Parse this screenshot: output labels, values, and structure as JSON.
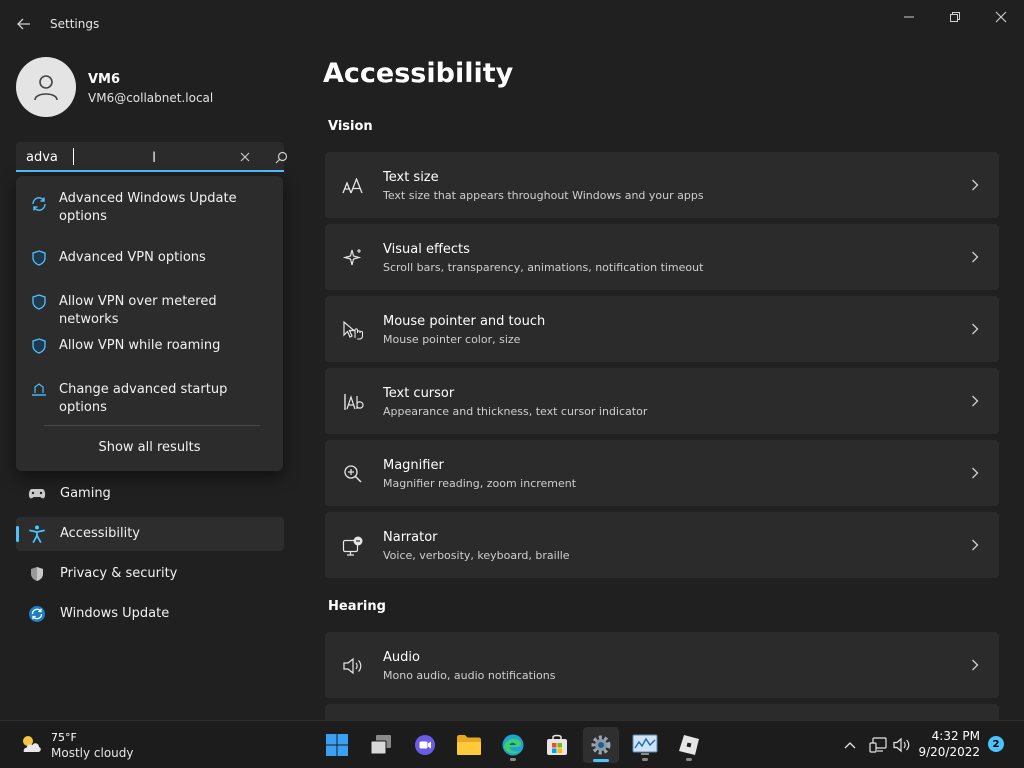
{
  "window": {
    "title": "Settings",
    "controls": [
      "minimize",
      "maximize",
      "close"
    ]
  },
  "user": {
    "name": "VM6",
    "email": "VM6@collabnet.local"
  },
  "search": {
    "value": "adva",
    "suggestions": [
      {
        "label": "Advanced Windows Update options",
        "icon": "sync-icon"
      },
      {
        "label": "Advanced VPN options",
        "icon": "shield-icon"
      },
      {
        "label": "Allow VPN over metered networks",
        "icon": "shield-icon"
      },
      {
        "label": "Allow VPN while roaming",
        "icon": "shield-icon"
      },
      {
        "label": "Change advanced startup options",
        "icon": "startup-icon"
      }
    ],
    "show_all": "Show all results"
  },
  "nav": {
    "items": [
      {
        "label": "Gaming",
        "icon": "gamepad-icon",
        "active": false
      },
      {
        "label": "Accessibility",
        "icon": "accessibility-icon",
        "active": true
      },
      {
        "label": "Privacy & security",
        "icon": "shield-icon",
        "active": false
      },
      {
        "label": "Windows Update",
        "icon": "sync-icon",
        "active": false
      }
    ]
  },
  "main": {
    "title": "Accessibility",
    "sections": [
      {
        "title": "Vision",
        "cards": [
          {
            "title": "Text size",
            "desc": "Text size that appears throughout Windows and your apps",
            "icon": "text-size-icon"
          },
          {
            "title": "Visual effects",
            "desc": "Scroll bars, transparency, animations, notification timeout",
            "icon": "sparkle-icon"
          },
          {
            "title": "Mouse pointer and touch",
            "desc": "Mouse pointer color, size",
            "icon": "pointer-icon"
          },
          {
            "title": "Text cursor",
            "desc": "Appearance and thickness, text cursor indicator",
            "icon": "text-cursor-icon"
          },
          {
            "title": "Magnifier",
            "desc": "Magnifier reading, zoom increment",
            "icon": "magnifier-icon"
          },
          {
            "title": "Narrator",
            "desc": "Voice, verbosity, keyboard, braille",
            "icon": "narrator-icon"
          }
        ]
      },
      {
        "title": "Hearing",
        "cards": [
          {
            "title": "Audio",
            "desc": "Mono audio, audio notifications",
            "icon": "speaker-icon"
          }
        ]
      }
    ]
  },
  "taskbar": {
    "weather": {
      "temp": "75°F",
      "desc": "Mostly cloudy",
      "icon": "partly-cloudy-icon"
    },
    "apps": [
      "start-icon",
      "task-view-icon",
      "chat-icon",
      "file-explorer-icon",
      "edge-icon",
      "store-icon",
      "settings-icon",
      "performance-monitor-icon",
      "roblox-icon"
    ],
    "active_app": "settings-icon",
    "clock": {
      "time": "4:32 PM",
      "date": "9/20/2022"
    },
    "notifications": "2"
  },
  "colors": {
    "accent": "#4cc2ff",
    "background": "#202020",
    "card": "#2b2b2b",
    "taskbar": "#1c1c1c"
  }
}
